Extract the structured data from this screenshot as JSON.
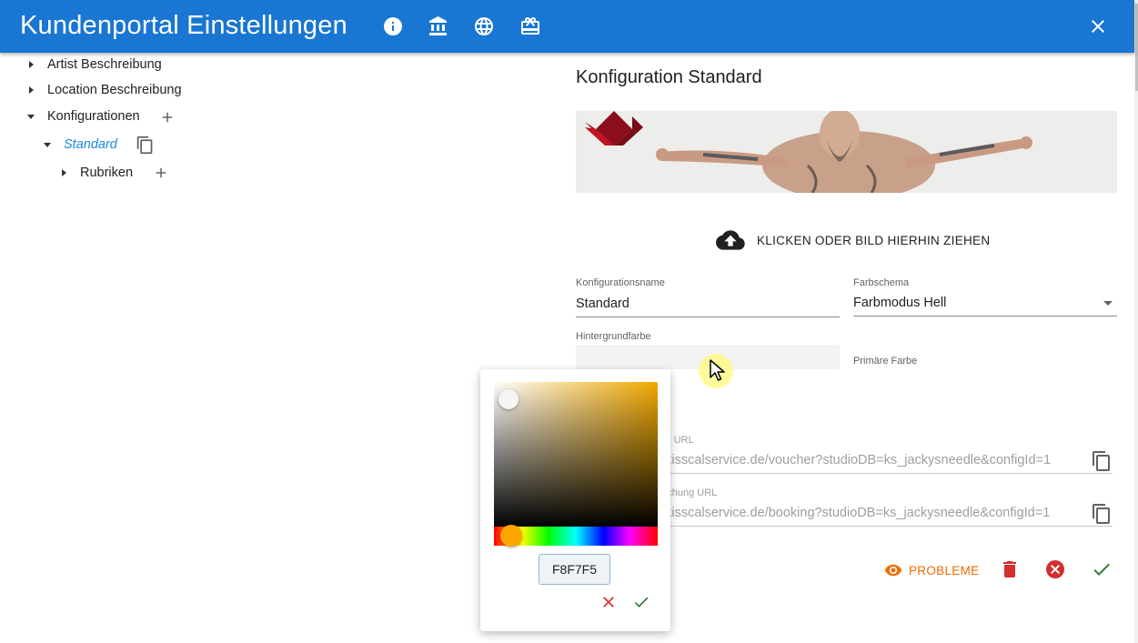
{
  "header": {
    "title": "Kundenportal Einstellungen",
    "icons": [
      "info-icon",
      "bank-icon",
      "globe-icon",
      "card-giftcard-icon"
    ],
    "close_icon": "close-icon",
    "color": "#1976d2"
  },
  "tree": {
    "items": [
      {
        "label": "Artist Beschreibung"
      },
      {
        "label": "Location Beschreibung"
      },
      {
        "label": "Konfigurationen"
      },
      {
        "label": "Standard"
      },
      {
        "label": "Rubriken"
      }
    ]
  },
  "config": {
    "title": "Konfiguration Standard",
    "upload_label": "KLICKEN ODER BILD HIERHIN ZIEHEN",
    "name_label": "Konfigurationsname",
    "name_value": "Standard",
    "scheme_label": "Farbschema",
    "scheme_value": "Farbmodus Hell",
    "bg_color_label": "Hintergrundfarbe",
    "primary_color_label": "Primäre Farbe",
    "voucher_label_partial": "ein URL",
    "voucher_url_partial": "g.kisscalservice.de/voucher?studioDB=ks_jackysneedle&configId=1",
    "booking_label_partial": "buchung URL",
    "booking_url_partial": "g.kisscalservice.de/booking?studioDB=ks_jackysneedle&configId=1",
    "problems_label": "PROBLEME"
  },
  "picker": {
    "hex_value": "F8F7F5",
    "accent": "#f0a800"
  },
  "colors": {
    "orange": "#ef6c00",
    "red": "#d32f2f",
    "green": "#2e7d32"
  }
}
